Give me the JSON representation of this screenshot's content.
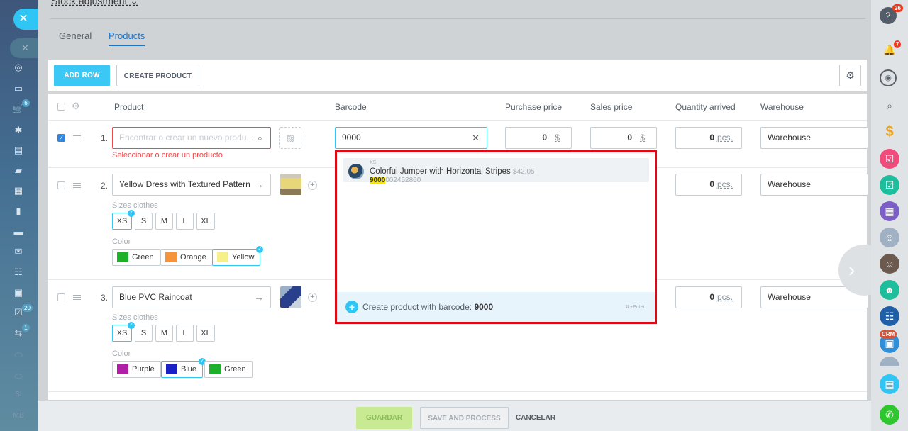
{
  "header": {
    "title": "Stock adjustment ⌄"
  },
  "tabs": [
    {
      "label": "General"
    },
    {
      "label": "Products"
    }
  ],
  "toolbar": {
    "add_row": "ADD ROW",
    "create_product": "CREATE PRODUCT"
  },
  "columns": {
    "product": "Product",
    "barcode": "Barcode",
    "purchase_price": "Purchase price",
    "sales_price": "Sales price",
    "quantity": "Quantity arrived",
    "warehouse": "Warehouse"
  },
  "row1": {
    "num": "1.",
    "search_placeholder": "Encontrar o crear un nuevo produ...",
    "error": "Seleccionar o crear un producto",
    "barcode_value": "9000",
    "purchase_value": "0",
    "purchase_currency": "$",
    "sales_value": "0",
    "sales_currency": "$",
    "qty_value": "0",
    "qty_unit": "pcs.",
    "warehouse": "Warehouse"
  },
  "row2": {
    "num": "2.",
    "name": "Yellow Dress with Textured Pattern",
    "sizes_label": "Sizes clothes",
    "sizes": [
      "XS",
      "S",
      "M",
      "L",
      "XL"
    ],
    "color_label": "Color",
    "colors": [
      {
        "name": "Green",
        "hex": "#1fb02a"
      },
      {
        "name": "Orange",
        "hex": "#f5943a"
      },
      {
        "name": "Yellow",
        "hex": "#f6f08a"
      }
    ],
    "qty_value": "0",
    "qty_unit": "pcs.",
    "warehouse": "Warehouse"
  },
  "row3": {
    "num": "3.",
    "name": "Blue PVC Raincoat",
    "sizes_label": "Sizes clothes",
    "sizes": [
      "XS",
      "S",
      "M",
      "L",
      "XL"
    ],
    "color_label": "Color",
    "colors": [
      {
        "name": "Purple",
        "hex": "#b01fa6"
      },
      {
        "name": "Blue",
        "hex": "#1a22c4"
      },
      {
        "name": "Green",
        "hex": "#1fb02a"
      }
    ],
    "qty_value": "0",
    "qty_unit": "pcs.",
    "warehouse": "Warehouse"
  },
  "dropdown": {
    "item_size": "XS",
    "item_name": "Colorful Jumper with Horizontal Stripes",
    "item_price": "$42.05",
    "barcode_match": "9000",
    "barcode_rest": "002452860",
    "create_text": "Create product with barcode:",
    "create_code": "9000",
    "shortcut": "⌘+Enter"
  },
  "footer": {
    "save": "GUARDAR",
    "save_process": "SAVE AND PROCESS",
    "cancel": "CANCELAR"
  },
  "left_sidebar": {
    "badges": {
      "cart": "6",
      "tasks": "20",
      "other": "1"
    },
    "labels": {
      "si": "SI",
      "mb": "MB"
    }
  },
  "right_sidebar": {
    "badges": {
      "help": "26",
      "bell": "7"
    },
    "crm": "CRM"
  },
  "colors": {
    "accent": "#2fc6f6",
    "error": "#f0494a",
    "highlight_border": "#e30613"
  }
}
